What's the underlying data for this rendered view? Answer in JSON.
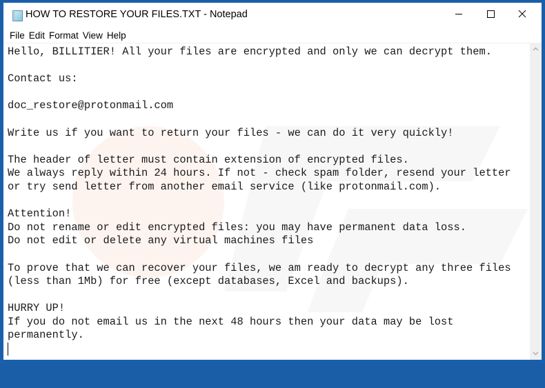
{
  "window": {
    "title": "HOW TO RESTORE YOUR FILES.TXT - Notepad",
    "app_icon": "notepad-icon",
    "controls": {
      "minimize": "minimize-icon",
      "maximize": "maximize-icon",
      "close": "close-icon"
    },
    "border_color": "#1b5faa"
  },
  "menu": {
    "items": [
      {
        "label": "File"
      },
      {
        "label": "Edit"
      },
      {
        "label": "Format"
      },
      {
        "label": "View"
      },
      {
        "label": "Help"
      }
    ]
  },
  "document": {
    "lines": [
      "Hello, BILLITIER! All your files are encrypted and only we can decrypt them.",
      "",
      "Contact us:",
      "",
      "doc_restore@protonmail.com",
      "",
      "Write us if you want to return your files - we can do it very quickly!",
      "",
      "The header of letter must contain extension of encrypted files.",
      "We always reply within 24 hours. If not - check spam folder, resend your letter",
      "or try send letter from another email service (like protonmail.com).",
      "",
      "Attention!",
      "Do not rename or edit encrypted files: you may have permanent data loss.",
      "Do not edit or delete any virtual machines files",
      "",
      "To prove that we can recover your files, we am ready to decrypt any three files",
      "(less than 1Mb) for free (except databases, Excel and backups).",
      "",
      "HURRY UP!",
      "If you do not email us in the next 48 hours then your data may be lost",
      "permanently.",
      ""
    ]
  },
  "scrollbar": {
    "up_icon": "chevron-up-icon",
    "down_icon": "chevron-down-icon"
  }
}
